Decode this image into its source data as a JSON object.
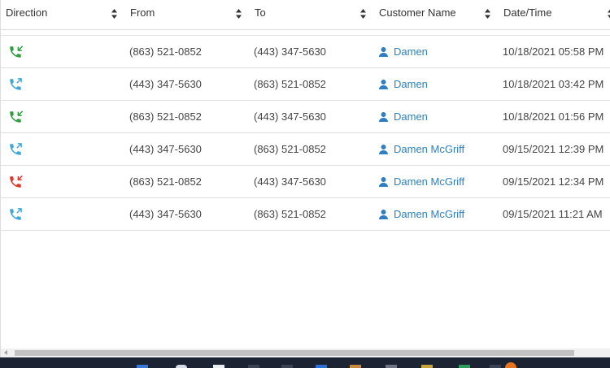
{
  "table": {
    "columns": [
      {
        "label": "Direction"
      },
      {
        "label": "From"
      },
      {
        "label": "To"
      },
      {
        "label": "Customer Name"
      },
      {
        "label": "Date/Time"
      }
    ],
    "rows": [
      {
        "direction": "incoming",
        "direction_icon": "incoming-call-icon",
        "color": "#2e9e3e",
        "from": "(863) 521-0852",
        "to": "(443) 347-5630",
        "customer": "Damen",
        "datetime": "10/18/2021 05:58 PM"
      },
      {
        "direction": "outgoing",
        "direction_icon": "outgoing-call-icon",
        "color": "#3aa9d6",
        "from": "(443) 347-5630",
        "to": "(863) 521-0852",
        "customer": "Damen",
        "datetime": "10/18/2021 03:42 PM"
      },
      {
        "direction": "incoming",
        "direction_icon": "incoming-call-icon",
        "color": "#2e9e3e",
        "from": "(863) 521-0852",
        "to": "(443) 347-5630",
        "customer": "Damen",
        "datetime": "10/18/2021 01:56 PM"
      },
      {
        "direction": "outgoing",
        "direction_icon": "outgoing-call-icon",
        "color": "#3aa9d6",
        "from": "(443) 347-5630",
        "to": "(863) 521-0852",
        "customer": "Damen McGriff",
        "datetime": "09/15/2021 12:39 PM"
      },
      {
        "direction": "missed",
        "direction_icon": "missed-call-icon",
        "color": "#e0342b",
        "from": "(863) 521-0852",
        "to": "(443) 347-5630",
        "customer": "Damen McGriff",
        "datetime": "09/15/2021 12:34 PM"
      },
      {
        "direction": "outgoing",
        "direction_icon": "outgoing-call-icon",
        "color": "#3aa9d6",
        "from": "(443) 347-5630",
        "to": "(863) 521-0852",
        "customer": "Damen McGriff",
        "datetime": "09/15/2021 11:21 AM"
      }
    ]
  },
  "colors": {
    "link": "#2f7fc0",
    "incoming": "#2e9e3e",
    "outgoing": "#3aa9d6",
    "missed": "#e0342b",
    "taskbar": "#1c2333"
  }
}
